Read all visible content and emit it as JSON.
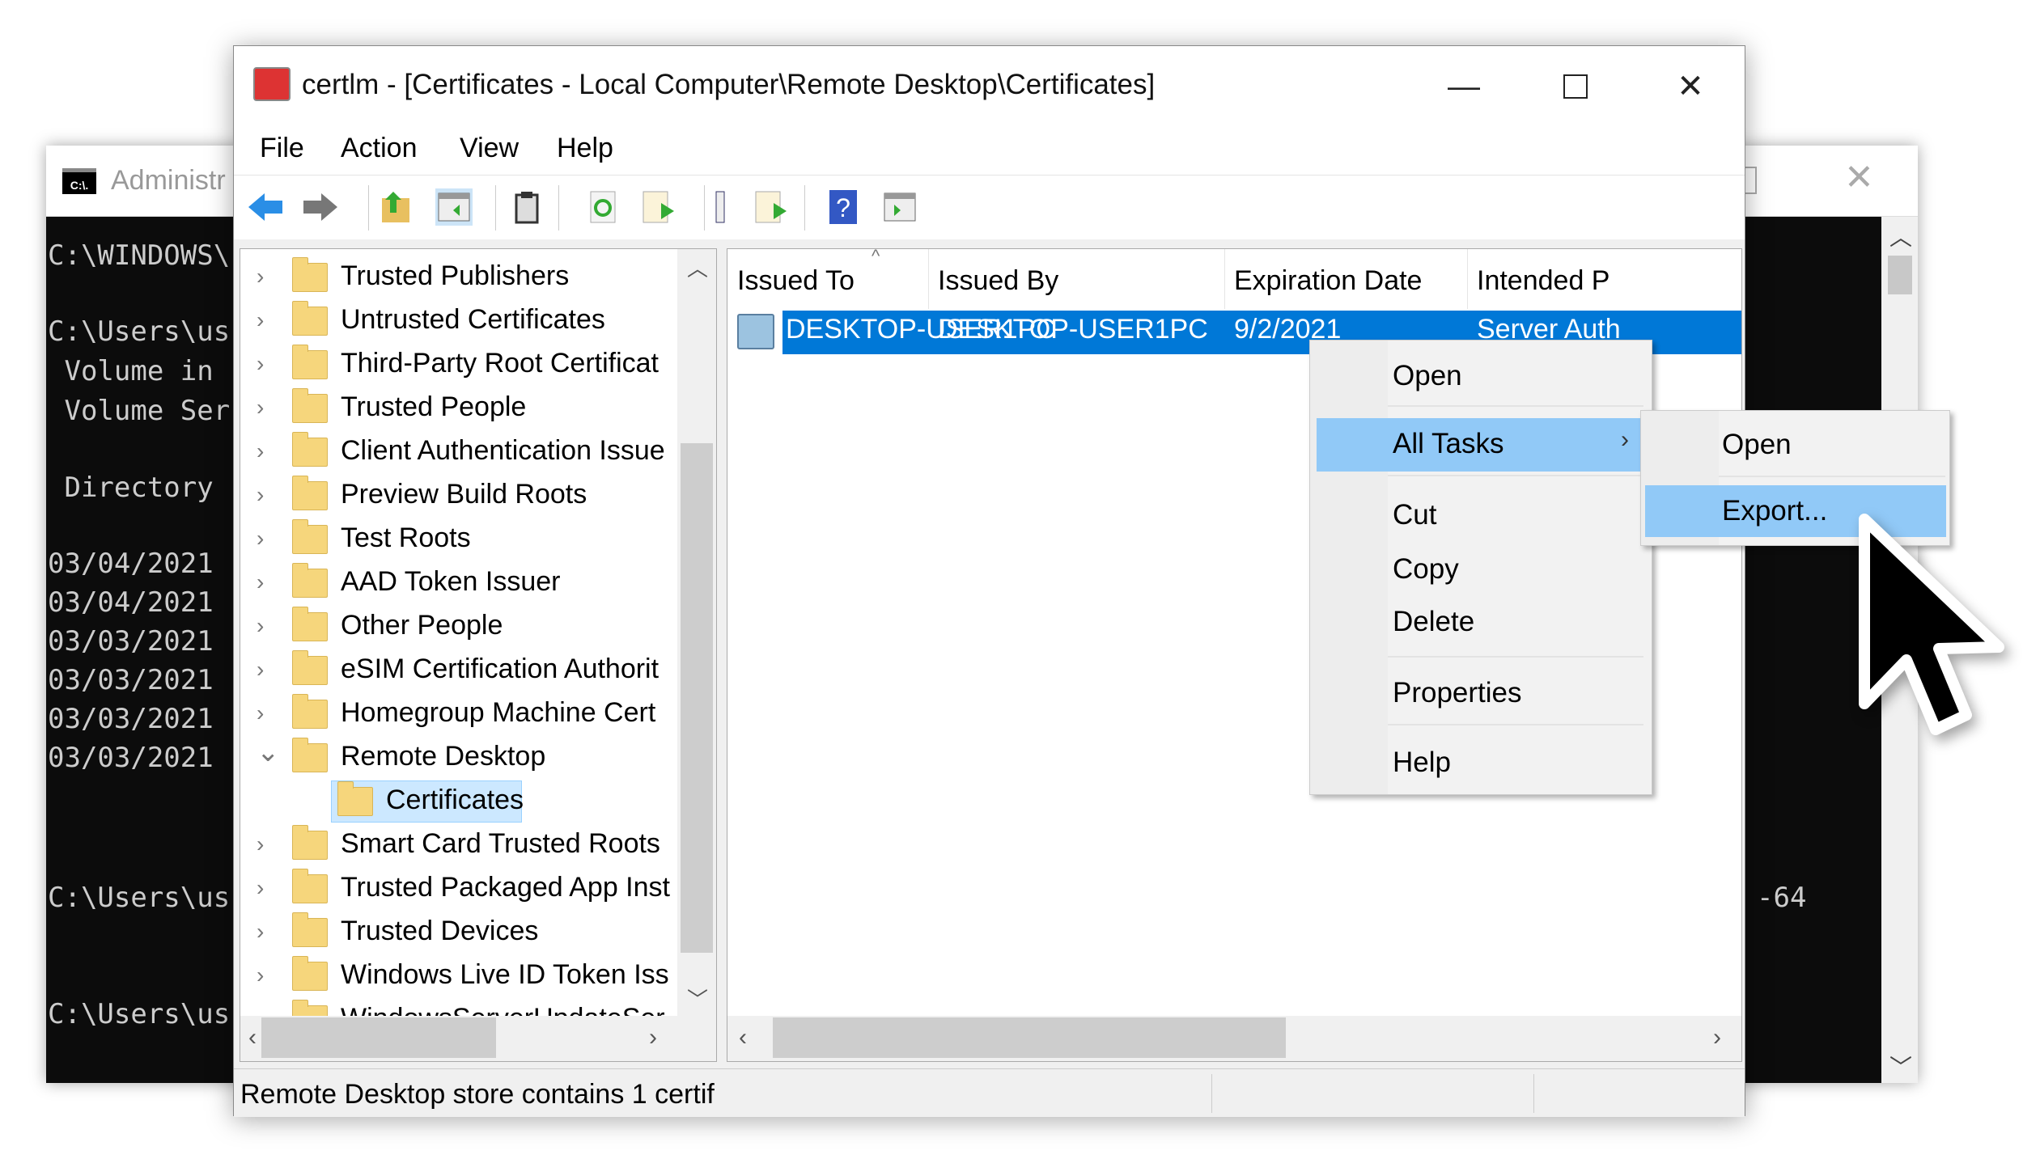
{
  "cmd_window": {
    "title": "Administr",
    "lines": [
      "C:\\WINDOWS\\",
      "",
      "C:\\Users\\us",
      " Volume in",
      " Volume Ser",
      "",
      " Directory",
      "",
      "03/04/2021",
      "03/04/2021",
      "03/03/2021",
      "03/03/2021",
      "03/03/2021",
      "03/03/2021"
    ],
    "prompt1": "C:\\Users\\us",
    "prompt2": "C:\\Users\\us",
    "right_text": "-64"
  },
  "window": {
    "title": "certlm - [Certificates - Local Computer\\Remote Desktop\\Certificates]"
  },
  "menu": [
    "File",
    "Action",
    "View",
    "Help"
  ],
  "toolbar": [
    "back-arrow-icon",
    "forward-arrow-icon",
    "up-folder-icon",
    "show-hide-tree-icon",
    "clipboard-icon",
    "refresh-icon",
    "export-list-icon",
    "properties-icon",
    "export-icon",
    "help-icon",
    "action-pane-icon"
  ],
  "tree": {
    "items": [
      {
        "label": "Trusted Publishers",
        "expanded": false
      },
      {
        "label": "Untrusted Certificates",
        "expanded": false
      },
      {
        "label": "Third-Party Root Certificat",
        "expanded": false
      },
      {
        "label": "Trusted People",
        "expanded": false
      },
      {
        "label": "Client Authentication Issue",
        "expanded": false
      },
      {
        "label": "Preview Build Roots",
        "expanded": false
      },
      {
        "label": "Test Roots",
        "expanded": false
      },
      {
        "label": "AAD Token Issuer",
        "expanded": false
      },
      {
        "label": "Other People",
        "expanded": false
      },
      {
        "label": "eSIM Certification Authorit",
        "expanded": false
      },
      {
        "label": "Homegroup Machine Cert",
        "expanded": false
      },
      {
        "label": "Remote Desktop",
        "expanded": true
      },
      {
        "label": "Certificates",
        "child": true,
        "selected": true
      },
      {
        "label": "Smart Card Trusted Roots",
        "expanded": false
      },
      {
        "label": "Trusted Packaged App Inst",
        "expanded": false
      },
      {
        "label": "Trusted Devices",
        "expanded": false
      },
      {
        "label": "Windows Live ID Token Iss",
        "expanded": false
      },
      {
        "label": "WindowsServerUpdateSer",
        "expanded": false
      }
    ]
  },
  "list": {
    "columns": [
      "Issued To",
      "Issued By",
      "Expiration Date",
      "Intended P"
    ],
    "rows": [
      [
        "DESKTOP-USER1PC",
        "DESKTOP-USER1PC",
        "9/2/2021",
        "Server Auth"
      ]
    ]
  },
  "context_menu": {
    "items": [
      "Open",
      "All Tasks",
      "Cut",
      "Copy",
      "Delete",
      "Properties",
      "Help"
    ],
    "highlighted": "All Tasks"
  },
  "submenu": {
    "items": [
      "Open",
      "Export..."
    ],
    "highlighted": "Export..."
  },
  "status": {
    "text": "Remote Desktop store contains 1 certif"
  },
  "colors": {
    "selection": "#0078d7",
    "menu_highlight": "#91c9f7"
  }
}
